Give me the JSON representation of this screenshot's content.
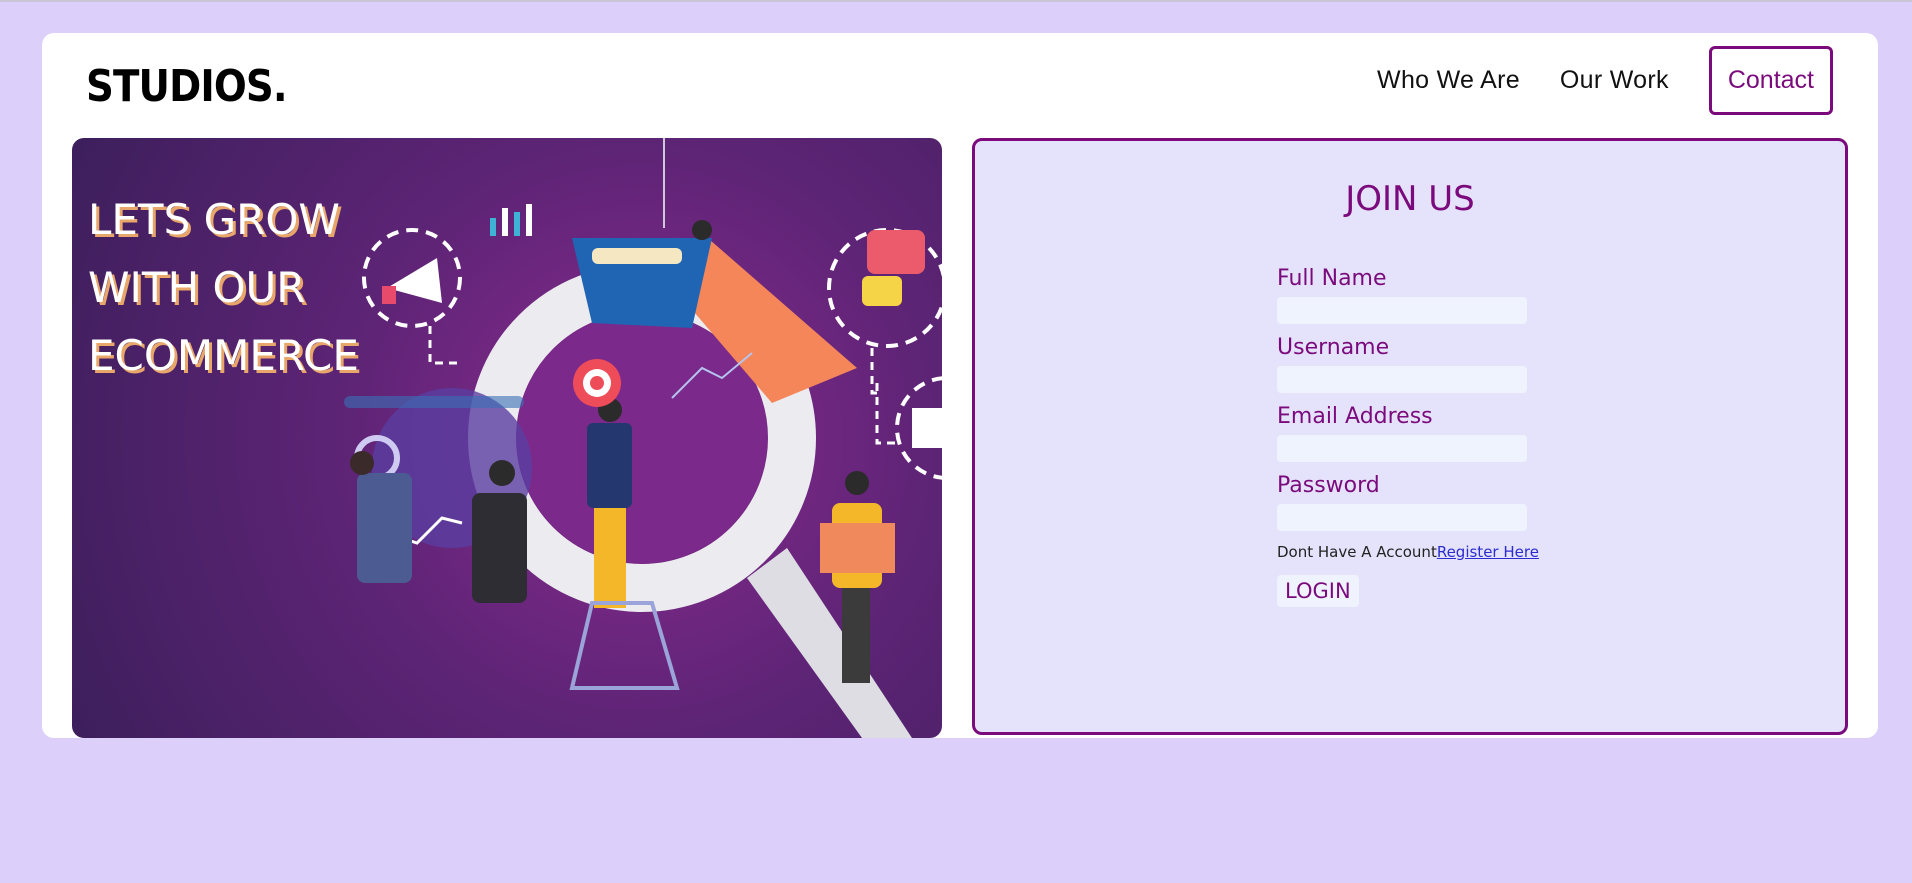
{
  "header": {
    "logo": "STUDIOS.",
    "nav": {
      "who_we_are": "Who We Are",
      "our_work": "Our Work",
      "contact": "Contact"
    }
  },
  "hero": {
    "title_line1": "LETS GROW",
    "title_line2": "WITH OUR",
    "title_line3": "ECOMMERCE"
  },
  "form": {
    "title": "JOIN US",
    "full_name_label": "Full Name",
    "username_label": "Username",
    "email_label": "Email Address",
    "password_label": "Password",
    "register_prompt": "Dont Have A Account",
    "register_link": "Register Here",
    "login_button": "LOGIN"
  },
  "colors": {
    "page_bg": "#dcd0fb",
    "accent": "#7b0a7d",
    "form_bg": "#e4e3fb"
  }
}
